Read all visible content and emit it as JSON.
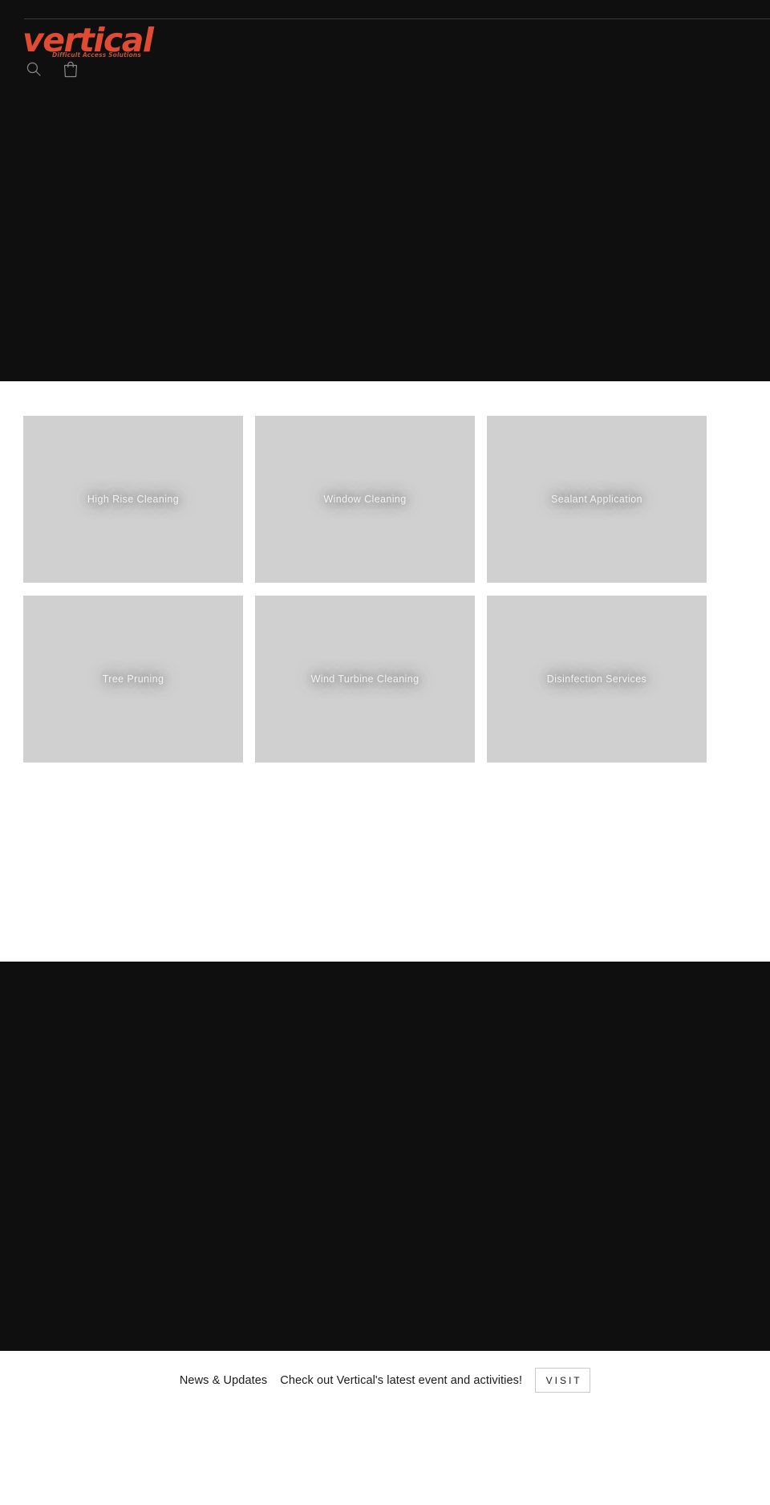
{
  "brand": {
    "name": "vertical",
    "tagline": "Difficult Access Solutions",
    "accent_color": "#e24b33",
    "tagline_color": "#b8543f"
  },
  "header": {
    "search_icon": "search-icon",
    "cart_icon": "shopping-bag-icon",
    "background_color": "#0f0f0f",
    "divider_color": "#3a3a3a"
  },
  "services": {
    "background_color": "#ffffff",
    "tile_color": "#d0d0d0",
    "tile_label_color": "#f2f2f2",
    "tiles": [
      {
        "label": "High Rise Cleaning"
      },
      {
        "label": "Window Cleaning"
      },
      {
        "label": "Sealant Application"
      },
      {
        "label": "Tree Pruning"
      },
      {
        "label": "Wind Turbine Cleaning"
      },
      {
        "label": "Disinfection Services"
      }
    ]
  },
  "feature_band": {
    "background_color": "#0f0f0f"
  },
  "news": {
    "label": "News & Updates",
    "message": "Check out Vertical's latest event and activities!",
    "button_label": "VISIT",
    "background_color": "#ffffff",
    "text_color": "#1a1a1a",
    "button_border_color": "#c9c9c9"
  }
}
